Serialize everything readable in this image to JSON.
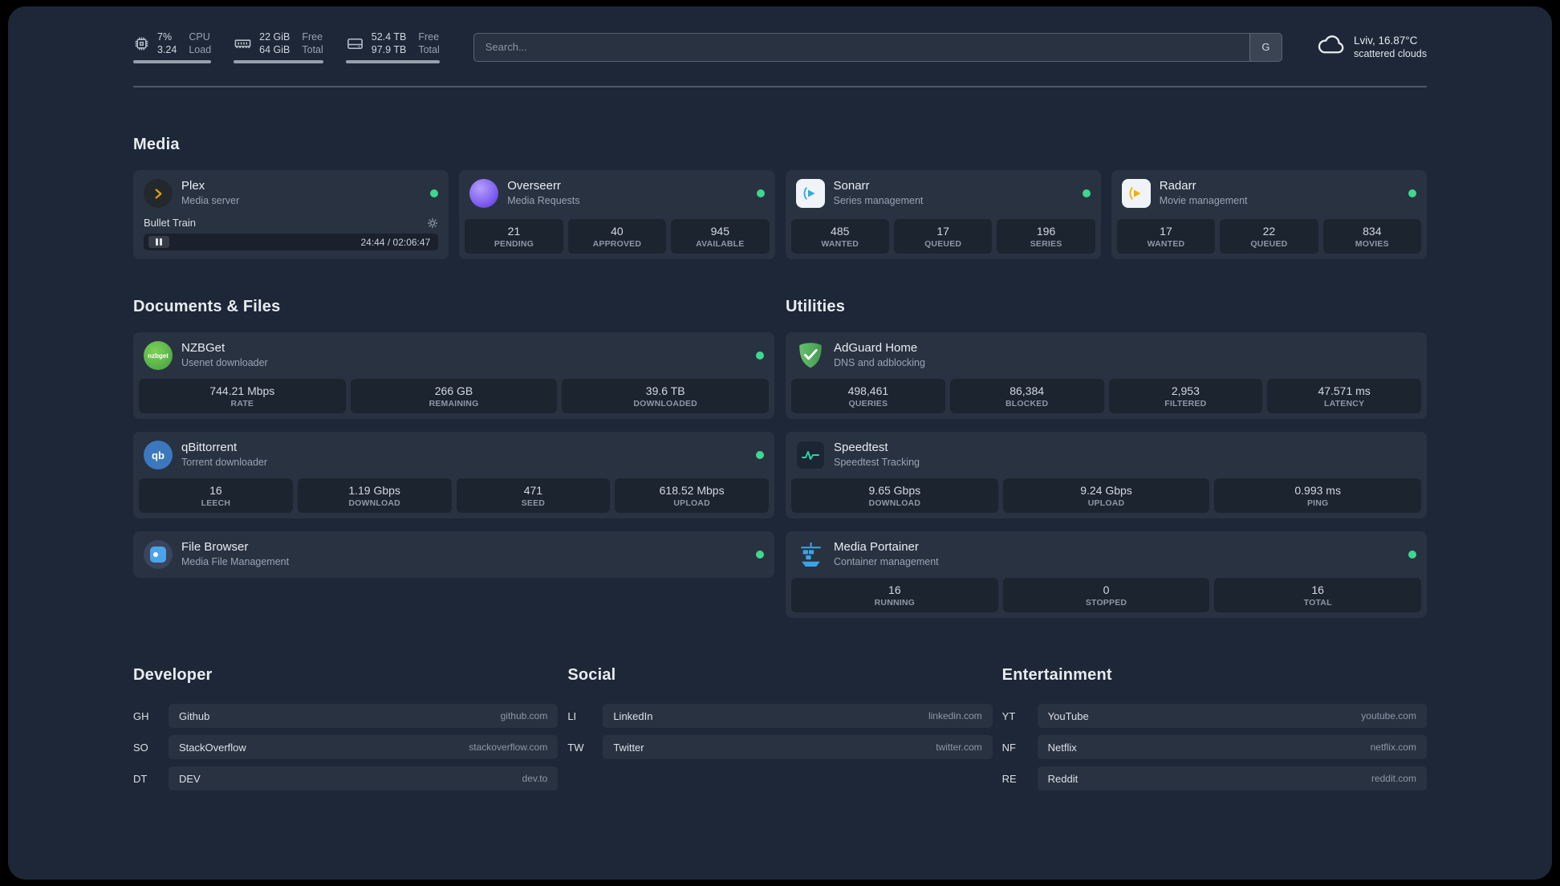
{
  "topbar": {
    "resources": [
      {
        "value_top": "7%",
        "value_bottom": "3.24",
        "label_top": "CPU",
        "label_bottom": "Load"
      },
      {
        "value_top": "22 GiB",
        "value_bottom": "64 GiB",
        "label_top": "Free",
        "label_bottom": "Total"
      },
      {
        "value_top": "52.4 TB",
        "value_bottom": "97.9 TB",
        "label_top": "Free",
        "label_bottom": "Total"
      }
    ],
    "search": {
      "placeholder": "Search...",
      "provider": "G"
    },
    "weather": {
      "location": "Lviv, 16.87°C",
      "condition": "scattered clouds"
    }
  },
  "media": {
    "heading": "Media",
    "plex": {
      "title": "Plex",
      "subtitle": "Media server",
      "now_playing": "Bullet Train",
      "time": "24:44 / 02:06:47"
    },
    "overseerr": {
      "title": "Overseerr",
      "subtitle": "Media Requests",
      "stats": [
        {
          "value": "21",
          "label": "PENDING"
        },
        {
          "value": "40",
          "label": "APPROVED"
        },
        {
          "value": "945",
          "label": "AVAILABLE"
        }
      ]
    },
    "sonarr": {
      "title": "Sonarr",
      "subtitle": "Series management",
      "stats": [
        {
          "value": "485",
          "label": "WANTED"
        },
        {
          "value": "17",
          "label": "QUEUED"
        },
        {
          "value": "196",
          "label": "SERIES"
        }
      ]
    },
    "radarr": {
      "title": "Radarr",
      "subtitle": "Movie management",
      "stats": [
        {
          "value": "17",
          "label": "WANTED"
        },
        {
          "value": "22",
          "label": "QUEUED"
        },
        {
          "value": "834",
          "label": "MOVIES"
        }
      ]
    }
  },
  "documents": {
    "heading": "Documents & Files",
    "nzbget": {
      "title": "NZBGet",
      "subtitle": "Usenet downloader",
      "stats": [
        {
          "value": "744.21 Mbps",
          "label": "RATE"
        },
        {
          "value": "266 GB",
          "label": "REMAINING"
        },
        {
          "value": "39.6 TB",
          "label": "DOWNLOADED"
        }
      ]
    },
    "qbittorrent": {
      "title": "qBittorrent",
      "subtitle": "Torrent downloader",
      "stats": [
        {
          "value": "16",
          "label": "LEECH"
        },
        {
          "value": "1.19 Gbps",
          "label": "DOWNLOAD"
        },
        {
          "value": "471",
          "label": "SEED"
        },
        {
          "value": "618.52 Mbps",
          "label": "UPLOAD"
        }
      ]
    },
    "filebrowser": {
      "title": "File Browser",
      "subtitle": "Media File Management"
    }
  },
  "utilities": {
    "heading": "Utilities",
    "adguard": {
      "title": "AdGuard Home",
      "subtitle": "DNS and adblocking",
      "stats": [
        {
          "value": "498,461",
          "label": "QUERIES"
        },
        {
          "value": "86,384",
          "label": "BLOCKED"
        },
        {
          "value": "2,953",
          "label": "FILTERED"
        },
        {
          "value": "47.571 ms",
          "label": "LATENCY"
        }
      ]
    },
    "speedtest": {
      "title": "Speedtest",
      "subtitle": "Speedtest Tracking",
      "stats": [
        {
          "value": "9.65 Gbps",
          "label": "DOWNLOAD"
        },
        {
          "value": "9.24 Gbps",
          "label": "UPLOAD"
        },
        {
          "value": "0.993 ms",
          "label": "PING"
        }
      ]
    },
    "portainer": {
      "title": "Media Portainer",
      "subtitle": "Container management",
      "stats": [
        {
          "value": "16",
          "label": "RUNNING"
        },
        {
          "value": "0",
          "label": "STOPPED"
        },
        {
          "value": "16",
          "label": "TOTAL"
        }
      ]
    }
  },
  "bookmarks": [
    {
      "heading": "Developer",
      "items": [
        {
          "abbr": "GH",
          "name": "Github",
          "domain": "github.com"
        },
        {
          "abbr": "SO",
          "name": "StackOverflow",
          "domain": "stackoverflow.com"
        },
        {
          "abbr": "DT",
          "name": "DEV",
          "domain": "dev.to"
        }
      ]
    },
    {
      "heading": "Social",
      "items": [
        {
          "abbr": "LI",
          "name": "LinkedIn",
          "domain": "linkedin.com"
        },
        {
          "abbr": "TW",
          "name": "Twitter",
          "domain": "twitter.com"
        }
      ]
    },
    {
      "heading": "Entertainment",
      "items": [
        {
          "abbr": "YT",
          "name": "YouTube",
          "domain": "youtube.com"
        },
        {
          "abbr": "NF",
          "name": "Netflix",
          "domain": "netflix.com"
        },
        {
          "abbr": "RE",
          "name": "Reddit",
          "domain": "reddit.com"
        }
      ]
    }
  ],
  "icons": {
    "nzbget_label": "nzbget",
    "qbittorrent_label": "qb"
  },
  "colors": {
    "status_online": "#3fd68f",
    "plex_amber": "#e5a00d",
    "overseerr_purple": "#6d3ef0",
    "sonarr_blue": "#2fa9e0",
    "radarr_amber": "#f0b000",
    "nzbget_green": "#4aa63e",
    "qbittorrent_blue": "#3b78bd",
    "filebrowser_blue": "#4da3ea",
    "adguard_green": "#54b05c",
    "speedtest_green": "#2ed3a0",
    "portainer_blue": "#3aa4e8"
  }
}
